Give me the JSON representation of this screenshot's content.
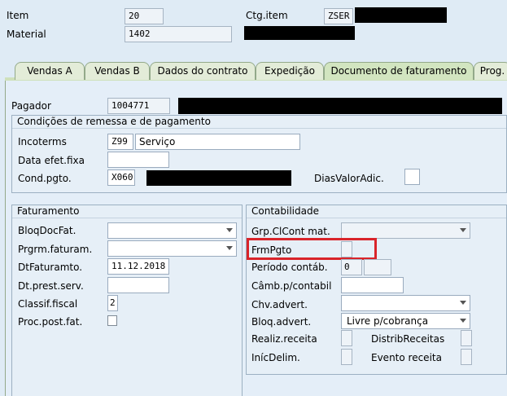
{
  "header": {
    "item_label": "Item",
    "item_value": "20",
    "ctg_item_label": "Ctg.item",
    "ctg_item_value": "ZSER",
    "material_label": "Material",
    "material_value": "1402"
  },
  "tabs": [
    {
      "label": "Vendas A"
    },
    {
      "label": "Vendas B"
    },
    {
      "label": "Dados do contrato"
    },
    {
      "label": "Expedição"
    },
    {
      "label": "Documento de faturamento"
    },
    {
      "label": "Prog."
    }
  ],
  "active_tab": "Documento de faturamento",
  "payer": {
    "label": "Pagador",
    "value": "1004771"
  },
  "conditions": {
    "title": "Condições de remessa e de pagamento",
    "incoterms_label": "Incoterms",
    "incoterms_code": "Z99",
    "incoterms_text": "Serviço",
    "data_efet_label": "Data efet.fixa",
    "data_efet_value": "",
    "cond_pgto_label": "Cond.pgto.",
    "cond_pgto_value": "X060",
    "dias_valor_label": "DiasValorAdic."
  },
  "billing": {
    "title": "Faturamento",
    "bloq_doc_label": "BloqDocFat.",
    "prgrm_label": "Prgrm.faturam.",
    "dt_fat_label": "DtFaturamto.",
    "dt_fat_value": "11.12.2018",
    "dt_prest_label": "Dt.prest.serv.",
    "classif_label": "Classif.fiscal",
    "classif_value": "2",
    "proc_post_label": "Proc.post.fat."
  },
  "accounting": {
    "title": "Contabilidade",
    "grp_cl_label": "Grp.ClCont mat.",
    "frm_pgto_label": "FrmPgto",
    "periodo_label": "Período contáb.",
    "periodo_value": "0",
    "camb_label": "Câmb.p/contabil",
    "chv_label": "Chv.advert.",
    "bloq_adv_label": "Bloq.advert.",
    "bloq_adv_value": "Livre p/cobrança",
    "realiz_label": "Realiz.receita",
    "distrib_label": "DistribReceitas",
    "inic_label": "InícDelim.",
    "evento_label": "Evento receita"
  },
  "colors": {
    "highlight_box": "#d9242a",
    "background": "#dfebf5",
    "tab_active": "#d2e5c0"
  }
}
